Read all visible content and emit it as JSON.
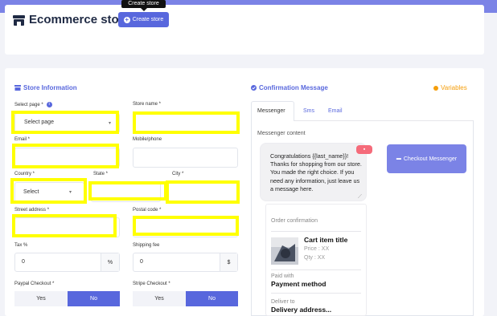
{
  "header": {
    "title": "Ecommerce store",
    "create_label": "Create store",
    "tooltip": "Create store"
  },
  "store_info": {
    "title": "Store Information",
    "select_page_label": "Select page *",
    "select_page_value": "Select page",
    "store_name_label": "Store name *",
    "email_label": "Email *",
    "mobile_label": "Mobile/phone",
    "country_label": "Country *",
    "country_value": "Select",
    "state_label": "State *",
    "city_label": "City *",
    "street_label": "Street address *",
    "postal_label": "Postal code *",
    "tax_label": "Tax %",
    "tax_value": "0",
    "tax_unit": "%",
    "shipping_label": "Shipping fee",
    "shipping_value": "0",
    "shipping_unit": "$",
    "paypal_label": "Paypal Checkout *",
    "stripe_label": "Stripe Checkout *",
    "yes": "Yes",
    "no": "No"
  },
  "confirmation": {
    "title": "Confirmation Message",
    "variables": "Variables",
    "tabs": [
      "Messenger",
      "Sms",
      "Email"
    ],
    "content_label": "Messenger content",
    "message": "Congratulations {{last_name}}! Thanks for shopping from our store. You made the right choice. If you need any information, just leave us a message here.",
    "checkout_button": "Checkout Messenger",
    "order": {
      "heading": "Order confirmation",
      "item_title": "Cart item title",
      "price": "Price : XX",
      "qty": "Qty : XX",
      "paid_with_label": "Paid with",
      "payment_method": "Payment method",
      "deliver_to_label": "Deliver to",
      "delivery_address": "Delivery address..."
    }
  },
  "colors": {
    "accent": "#5867dd",
    "highlight": "#ffff00",
    "variables": "#f59e0b"
  }
}
